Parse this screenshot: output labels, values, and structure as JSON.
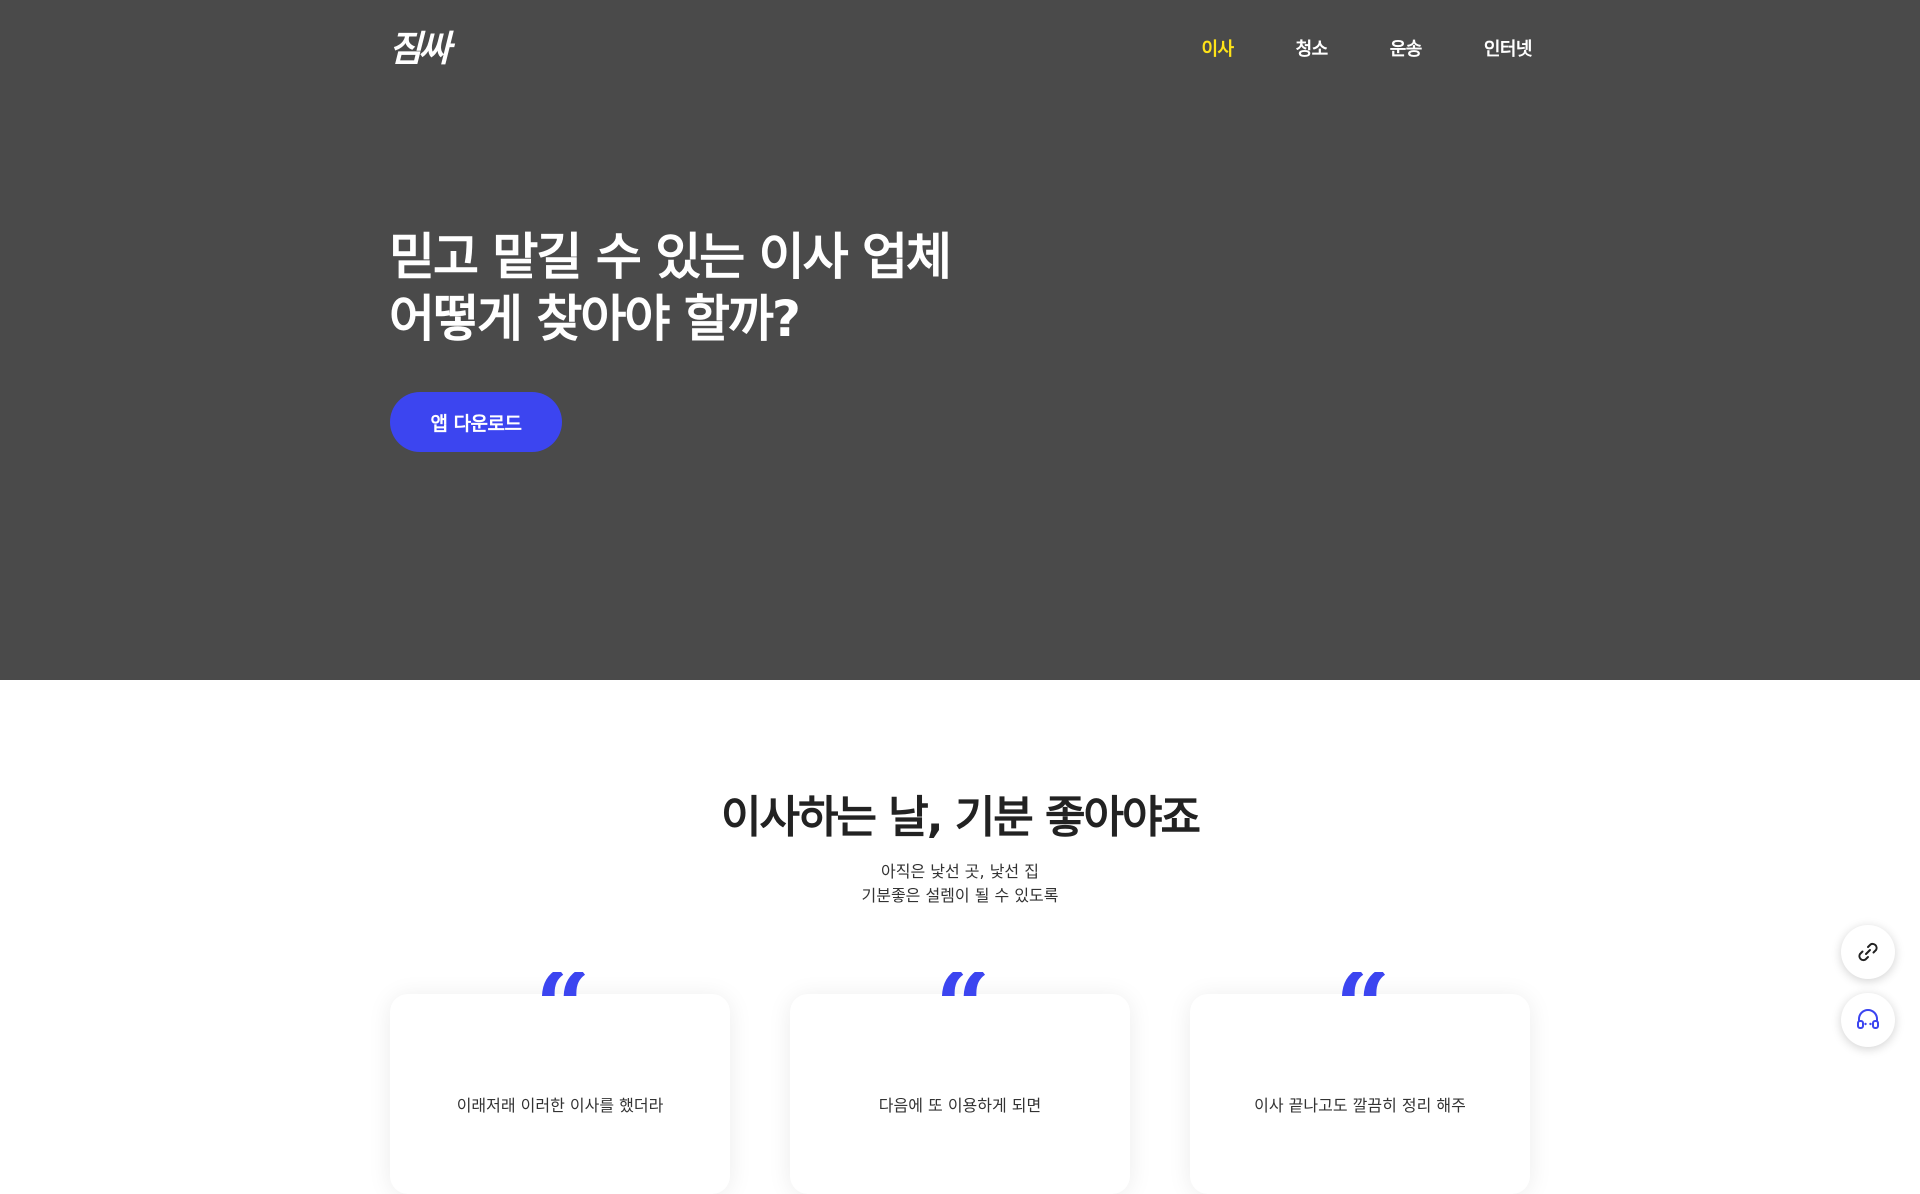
{
  "header": {
    "logo": "짐싸",
    "nav": [
      {
        "label": "이사",
        "active": true
      },
      {
        "label": "청소",
        "active": false
      },
      {
        "label": "운송",
        "active": false
      },
      {
        "label": "인터넷",
        "active": false
      }
    ]
  },
  "hero": {
    "title_line1": "믿고 맡길 수 있는 이사 업체",
    "title_line2": "어떻게 찾아야 할까?",
    "cta_label": "앱 다운로드"
  },
  "section": {
    "title": "이사하는 날, 기분 좋아야죠",
    "sub_line1": "아직은 낯선 곳, 낯선 집",
    "sub_line2": "기분좋은 설렘이 될 수 있도록"
  },
  "cards": [
    {
      "quote": "“",
      "text": "이래저래 이러한 이사를 했더라"
    },
    {
      "quote": "“",
      "text": "다음에 또 이용하게 되면"
    },
    {
      "quote": "“",
      "text": "이사 끝나고도 깔끔히 정리 해주"
    }
  ],
  "floating": {
    "link_icon": "link-icon",
    "support_icon": "headset-icon"
  },
  "colors": {
    "hero_bg": "#4a4a4a",
    "accent": "#3c45f0",
    "nav_active": "#ffe318"
  }
}
